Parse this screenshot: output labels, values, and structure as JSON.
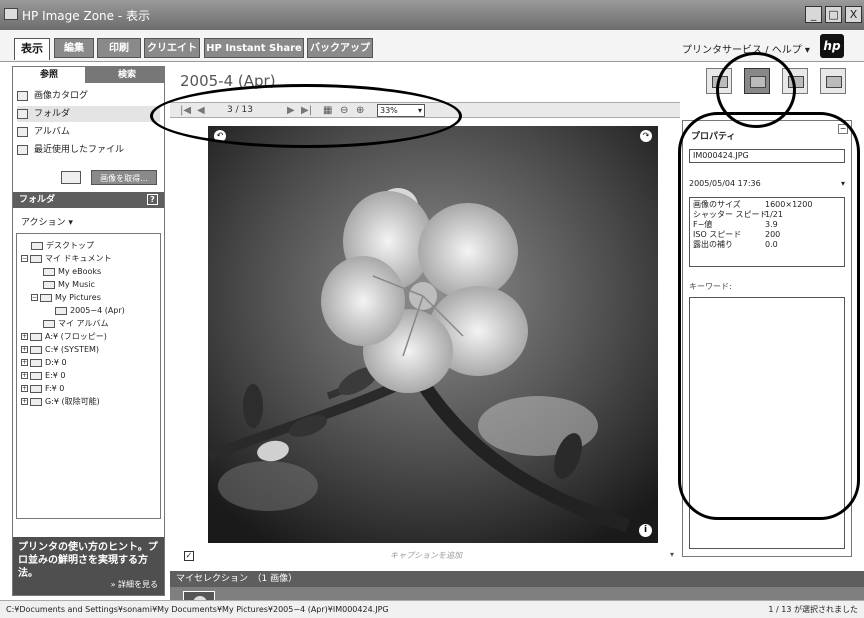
{
  "window": {
    "title": "HP Image Zone - 表示",
    "buttons": {
      "minimize": "_",
      "maximize": "□",
      "close": "X"
    }
  },
  "tabs": [
    "表示",
    "編集",
    "印刷",
    "クリエイト",
    "HP Instant Share",
    "バックアップ"
  ],
  "active_tab": 0,
  "help_link": "プリンタサービス / ヘルプ ▾",
  "logo": "hp",
  "left_panel": {
    "tabs": [
      "参照",
      "検索"
    ],
    "nav_items": [
      "画像カタログ",
      "フォルダ",
      "アルバム",
      "最近使用したファイル"
    ],
    "selected_nav": 1,
    "get_images_label": "画像を取得...",
    "folder_header": "フォルダ",
    "help_icon": "?",
    "action_menu": "アクション ▾",
    "tree": [
      {
        "label": "デスクトップ",
        "level": 1,
        "expander": ""
      },
      {
        "label": "マイ ドキュメント",
        "level": 0,
        "expander": "−"
      },
      {
        "label": "My eBooks",
        "level": 2,
        "expander": ""
      },
      {
        "label": "My Music",
        "level": 2,
        "expander": ""
      },
      {
        "label": "My Pictures",
        "level": 1,
        "expander": "−"
      },
      {
        "label": "2005−4 (Apr)",
        "level": 3,
        "expander": ""
      },
      {
        "label": "マイ アルバム",
        "level": 2,
        "expander": ""
      },
      {
        "label": "A:¥ (フロッピー)",
        "level": 0,
        "expander": "+"
      },
      {
        "label": "C:¥ (SYSTEM)",
        "level": 0,
        "expander": "+"
      },
      {
        "label": "D:¥ 0",
        "level": 0,
        "expander": "+"
      },
      {
        "label": "E:¥ 0",
        "level": 0,
        "expander": "+"
      },
      {
        "label": "F:¥ 0",
        "level": 0,
        "expander": "+"
      },
      {
        "label": "G:¥ (取除可能)",
        "level": 0,
        "expander": "+"
      }
    ],
    "hint": {
      "text": "プリンタの使い方のヒント。プロ並みの鮮明さを実現する方法。",
      "more": "» 詳細を見る"
    }
  },
  "main": {
    "folder_title": "2005-4 (Apr)",
    "nav": {
      "first": "|◀",
      "prev": "◀",
      "counter": "3 / 13",
      "next": "▶",
      "last": "▶|",
      "zoom": "33%"
    },
    "rotate_left": "↶",
    "rotate_right": "↷",
    "info_icon": "i",
    "caption_checked": "✓",
    "caption_placeholder": "キャプションを追加",
    "caption_arrow": "▾",
    "selection_bar": "マイセレクション　（1 画像）"
  },
  "properties": {
    "title": "プロパティ",
    "collapse": "−",
    "filename": "IM000424.JPG",
    "date": "2005/05/04 17:36",
    "date_arrow": "▾",
    "rows": [
      {
        "label": "画像のサイズ",
        "value": "1600×1200"
      },
      {
        "label": "シャッター スピード",
        "value": "1/21"
      },
      {
        "label": "F−値",
        "value": "3.9"
      },
      {
        "label": "ISO スピード",
        "value": "200"
      },
      {
        "label": "露出の補り",
        "value": "0.0"
      }
    ],
    "keyword_label": "キーワード:"
  },
  "status": {
    "path": "C:¥Documents and Settings¥sonami¥My Documents¥My Pictures¥2005−4 (Apr)¥IM000424.JPG",
    "count": "1 / 13 が選択されました"
  }
}
